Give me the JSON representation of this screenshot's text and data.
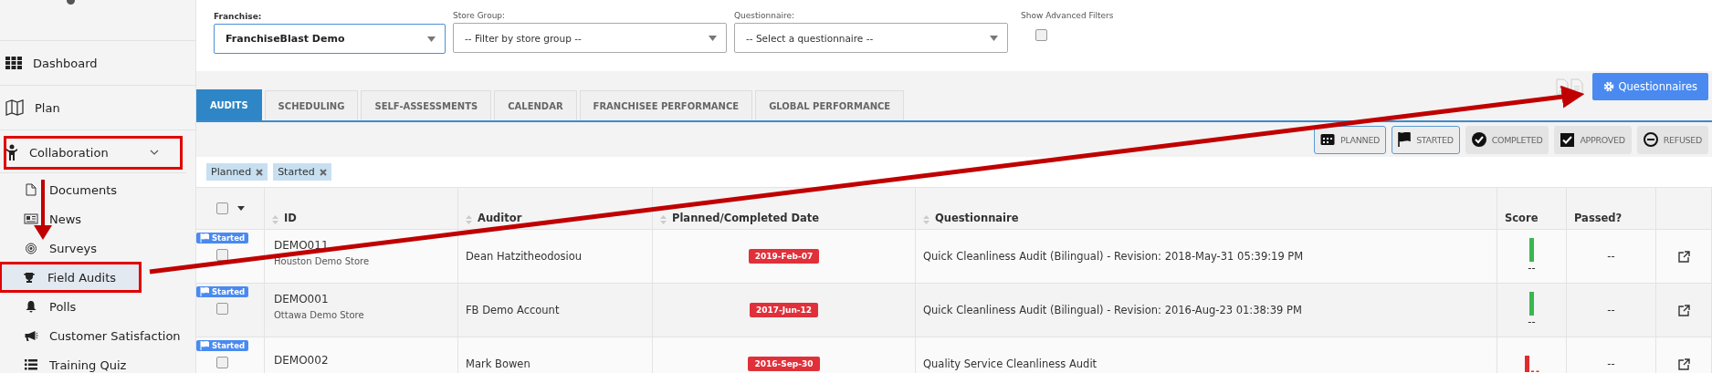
{
  "sidebar": {
    "items": [
      {
        "label": "Dashboard",
        "selected": false,
        "callout": false
      },
      {
        "label": "Plan",
        "selected": false,
        "callout": false
      },
      {
        "label": "Collaboration",
        "selected": false,
        "callout": true,
        "expanded": true,
        "children": [
          {
            "label": "Documents",
            "selected": false,
            "callout": false
          },
          {
            "label": "News",
            "selected": false,
            "callout": false
          },
          {
            "label": "Surveys",
            "selected": false,
            "callout": false
          },
          {
            "label": "Field Audits",
            "selected": true,
            "callout": true
          },
          {
            "label": "Polls",
            "selected": false,
            "callout": false
          },
          {
            "label": "Customer Satisfaction",
            "selected": false,
            "callout": false
          },
          {
            "label": "Training Quiz",
            "selected": false,
            "callout": false
          }
        ]
      }
    ]
  },
  "filters": [
    {
      "label": "Franchise:",
      "value": "FranchiseBlast Demo",
      "focused": true
    },
    {
      "label": "Store Group:",
      "placeholder": "-- Filter by store group --",
      "focused": false
    },
    {
      "label": "Questionnaire:",
      "placeholder": "-- Select a questionnaire --",
      "focused": false
    }
  ],
  "advanced_filters": {
    "label": "Show Advanced Filters",
    "checked": false
  },
  "questionnaires_button": "Questionnaires",
  "tabs": [
    {
      "label": "AUDITS",
      "selected": true
    },
    {
      "label": "SCHEDULING",
      "selected": false
    },
    {
      "label": "SELF-ASSESSMENTS",
      "selected": false
    },
    {
      "label": "CALENDAR",
      "selected": false
    },
    {
      "label": "FRANCHISEE PERFORMANCE",
      "selected": false
    },
    {
      "label": "GLOBAL PERFORMANCE",
      "selected": false
    }
  ],
  "status_filters": [
    {
      "label": "PLANNED",
      "selected": true
    },
    {
      "label": "STARTED",
      "selected": true
    },
    {
      "label": "COMPLETED",
      "selected": false
    },
    {
      "label": "APPROVED",
      "selected": false
    },
    {
      "label": "REFUSED",
      "selected": false
    }
  ],
  "active_chips": [
    "Planned",
    "Started"
  ],
  "table": {
    "select_all_checked": false,
    "columns": [
      "ID",
      "Auditor",
      "Planned/Completed Date",
      "Questionnaire",
      "Score",
      "Passed?"
    ],
    "rows": [
      {
        "badge": "Started",
        "id": "DEMO011",
        "store": "Houston Demo Store",
        "auditor": "Dean Hatzitheodosiou",
        "date": "2019-Feb-07",
        "questionnaire": "Quick Cleanliness Audit (Bilingual) - Revision: 2018-May-31 05:39:19 PM",
        "color": "#3cb550",
        "score": "--",
        "passed": "--",
        "checked": false
      },
      {
        "badge": "Started",
        "id": "DEMO001",
        "store": "Ottawa Demo Store",
        "auditor": "FB Demo Account",
        "date": "2017-Jun-12",
        "questionnaire": "Quick Cleanliness Audit (Bilingual) - Revision: 2016-Aug-23 01:38:39 PM",
        "color": "#3cb550",
        "score": "--",
        "passed": "--",
        "checked": false
      },
      {
        "badge": "Started",
        "id": "DEMO002",
        "auditor": "Mark Bowen",
        "date": "2016-Sep-30",
        "questionnaire": "Quality Service Cleanliness Audit",
        "color": "#e02b2b",
        "passed": "--",
        "checked": false
      }
    ]
  }
}
